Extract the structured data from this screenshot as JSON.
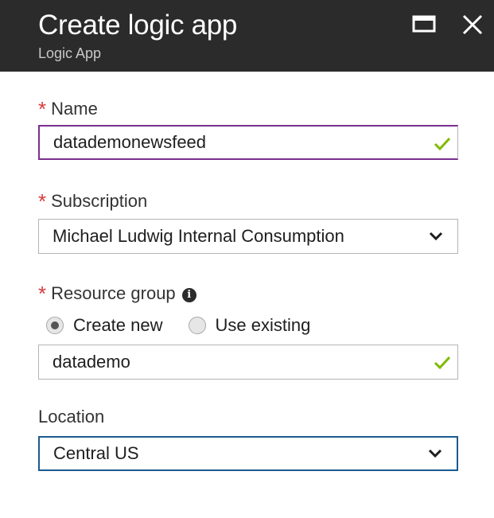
{
  "header": {
    "title": "Create logic app",
    "subtitle": "Logic App",
    "maximize_icon": "maximize-icon",
    "close_icon": "close-icon"
  },
  "form": {
    "name": {
      "label": "Name",
      "required": true,
      "value": "datademonewsfeed",
      "valid": true
    },
    "subscription": {
      "label": "Subscription",
      "required": true,
      "selected": "Michael Ludwig Internal Consumption"
    },
    "resource_group": {
      "label": "Resource group",
      "required": true,
      "info_icon": "info-icon",
      "options": [
        {
          "label": "Create new",
          "checked": true
        },
        {
          "label": "Use existing",
          "checked": false
        }
      ],
      "value": "datademo",
      "valid": true
    },
    "location": {
      "label": "Location",
      "required": false,
      "selected": "Central US"
    }
  },
  "colors": {
    "header_bg": "#2b2b2b",
    "required_star": "#d83b3b",
    "valid_check": "#7fba00",
    "focus_border_name": "#7a2f8f",
    "focus_border_location": "#1b5a8f"
  }
}
